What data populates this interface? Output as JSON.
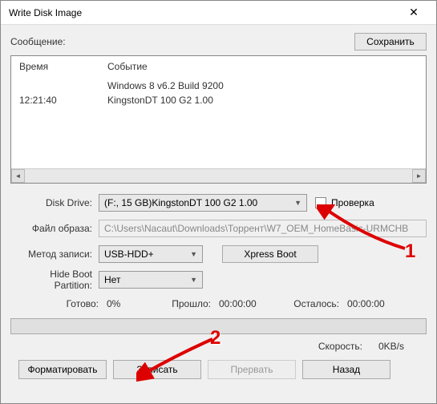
{
  "window": {
    "title": "Write Disk Image"
  },
  "message_label": "Сообщение:",
  "save_button": "Сохранить",
  "log": {
    "header_time": "Время",
    "header_event": "Событие",
    "rows": [
      {
        "time": "",
        "event": "Windows 8 v6.2 Build 9200"
      },
      {
        "time": "12:21:40",
        "event": "KingstonDT 100 G2        1.00"
      }
    ]
  },
  "form": {
    "disk_drive_label": "Disk Drive:",
    "disk_drive_value": "(F:, 15 GB)KingstonDT 100 G2      1.00",
    "check_label": "Проверка",
    "image_label": "Файл образа:",
    "image_value": "C:\\Users\\Nacaut\\Downloads\\Торрент\\W7_OEM_HomeBasic-URMCHB",
    "write_method_label": "Метод записи:",
    "write_method_value": "USB-HDD+",
    "xpress_boot": "Xpress Boot",
    "hide_boot_label": "Hide Boot Partition:",
    "hide_boot_value": "Нет"
  },
  "stats": {
    "ready_label": "Готово:",
    "ready_value": "0%",
    "elapsed_label": "Прошло:",
    "elapsed_value": "00:00:00",
    "remain_label": "Осталось:",
    "remain_value": "00:00:00",
    "speed_label": "Скорость:",
    "speed_value": "0KB/s"
  },
  "buttons": {
    "format": "Форматировать",
    "write": "Записать",
    "abort": "Прервать",
    "back": "Назад"
  },
  "annotations": {
    "num1": "1",
    "num2": "2"
  }
}
